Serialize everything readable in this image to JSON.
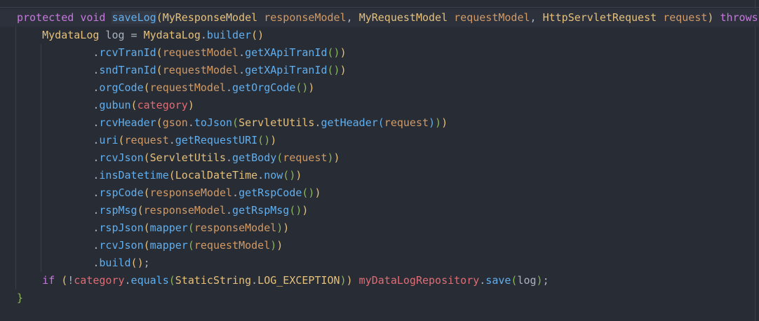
{
  "editor": {
    "current_line": 0,
    "lines": [
      {
        "indent": 0,
        "tokens": [
          [
            "protected",
            "kw"
          ],
          [
            " ",
            "pl"
          ],
          [
            "void",
            "kw"
          ],
          [
            " ",
            "pl"
          ],
          [
            "saveLog",
            "fn hl"
          ],
          [
            "(",
            "b1"
          ],
          [
            "MyResponseModel",
            "ty"
          ],
          [
            " ",
            "pl"
          ],
          [
            "responseModel",
            "pa"
          ],
          [
            ", ",
            "pl"
          ],
          [
            "MyRequestModel",
            "ty"
          ],
          [
            " ",
            "pl"
          ],
          [
            "requestModel",
            "pa"
          ],
          [
            ", ",
            "pl"
          ],
          [
            "HttpServletRequest",
            "ty"
          ],
          [
            " ",
            "pl"
          ],
          [
            "request",
            "pa"
          ],
          [
            ")",
            "b1"
          ],
          [
            " ",
            "pl"
          ],
          [
            "throws",
            "kw"
          ]
        ]
      },
      {
        "indent": 4,
        "tokens": [
          [
            "MydataLog",
            "ty"
          ],
          [
            " log = ",
            "pl"
          ],
          [
            "MydataLog",
            "ty"
          ],
          [
            ".",
            "pl"
          ],
          [
            "builder",
            "fn"
          ],
          [
            "()",
            "b1"
          ]
        ]
      },
      {
        "indent": 12,
        "tokens": [
          [
            ".",
            "pl"
          ],
          [
            "rcvTranId",
            "fn"
          ],
          [
            "(",
            "b1"
          ],
          [
            "requestModel",
            "pa"
          ],
          [
            ".",
            "pl"
          ],
          [
            "getXApiTranId",
            "fn"
          ],
          [
            "()",
            "b2"
          ],
          [
            ")",
            "b1"
          ]
        ]
      },
      {
        "indent": 12,
        "tokens": [
          [
            ".",
            "pl"
          ],
          [
            "sndTranId",
            "fn"
          ],
          [
            "(",
            "b1"
          ],
          [
            "requestModel",
            "pa"
          ],
          [
            ".",
            "pl"
          ],
          [
            "getXApiTranId",
            "fn"
          ],
          [
            "()",
            "b2"
          ],
          [
            ")",
            "b1"
          ]
        ]
      },
      {
        "indent": 12,
        "tokens": [
          [
            ".",
            "pl"
          ],
          [
            "orgCode",
            "fn"
          ],
          [
            "(",
            "b1"
          ],
          [
            "requestModel",
            "pa"
          ],
          [
            ".",
            "pl"
          ],
          [
            "getOrgCode",
            "fn"
          ],
          [
            "()",
            "b2"
          ],
          [
            ")",
            "b1"
          ]
        ]
      },
      {
        "indent": 12,
        "tokens": [
          [
            ".",
            "pl"
          ],
          [
            "gubun",
            "fn"
          ],
          [
            "(",
            "b1"
          ],
          [
            "category",
            "fi"
          ],
          [
            ")",
            "b1"
          ]
        ]
      },
      {
        "indent": 12,
        "tokens": [
          [
            ".",
            "pl"
          ],
          [
            "rcvHeader",
            "fn"
          ],
          [
            "(",
            "b1"
          ],
          [
            "gson",
            "pa"
          ],
          [
            ".",
            "pl"
          ],
          [
            "toJson",
            "fn"
          ],
          [
            "(",
            "b2"
          ],
          [
            "ServletUtils",
            "ty"
          ],
          [
            ".",
            "pl"
          ],
          [
            "getHeader",
            "fn"
          ],
          [
            "(",
            "b3"
          ],
          [
            "request",
            "pa"
          ],
          [
            ")",
            "b3"
          ],
          [
            ")",
            "b2"
          ],
          [
            ")",
            "b1"
          ]
        ]
      },
      {
        "indent": 12,
        "tokens": [
          [
            ".",
            "pl"
          ],
          [
            "uri",
            "fn"
          ],
          [
            "(",
            "b1"
          ],
          [
            "request",
            "pa"
          ],
          [
            ".",
            "pl"
          ],
          [
            "getRequestURI",
            "fn"
          ],
          [
            "()",
            "b2"
          ],
          [
            ")",
            "b1"
          ]
        ]
      },
      {
        "indent": 12,
        "tokens": [
          [
            ".",
            "pl"
          ],
          [
            "rcvJson",
            "fn"
          ],
          [
            "(",
            "b1"
          ],
          [
            "ServletUtils",
            "ty"
          ],
          [
            ".",
            "pl"
          ],
          [
            "getBody",
            "fn"
          ],
          [
            "(",
            "b2"
          ],
          [
            "request",
            "pa"
          ],
          [
            ")",
            "b2"
          ],
          [
            ")",
            "b1"
          ]
        ]
      },
      {
        "indent": 12,
        "tokens": [
          [
            ".",
            "pl"
          ],
          [
            "insDatetime",
            "fn"
          ],
          [
            "(",
            "b1"
          ],
          [
            "LocalDateTime",
            "ty"
          ],
          [
            ".",
            "pl"
          ],
          [
            "now",
            "fn"
          ],
          [
            "()",
            "b2"
          ],
          [
            ")",
            "b1"
          ]
        ]
      },
      {
        "indent": 12,
        "tokens": [
          [
            ".",
            "pl"
          ],
          [
            "rspCode",
            "fn"
          ],
          [
            "(",
            "b1"
          ],
          [
            "responseModel",
            "pa"
          ],
          [
            ".",
            "pl"
          ],
          [
            "getRspCode",
            "fn"
          ],
          [
            "()",
            "b2"
          ],
          [
            ")",
            "b1"
          ]
        ]
      },
      {
        "indent": 12,
        "tokens": [
          [
            ".",
            "pl"
          ],
          [
            "rspMsg",
            "fn"
          ],
          [
            "(",
            "b1"
          ],
          [
            "responseModel",
            "pa"
          ],
          [
            ".",
            "pl"
          ],
          [
            "getRspMsg",
            "fn"
          ],
          [
            "()",
            "b2"
          ],
          [
            ")",
            "b1"
          ]
        ]
      },
      {
        "indent": 12,
        "tokens": [
          [
            ".",
            "pl"
          ],
          [
            "rspJson",
            "fn"
          ],
          [
            "(",
            "b1"
          ],
          [
            "mapper",
            "fn"
          ],
          [
            "(",
            "b2"
          ],
          [
            "responseModel",
            "pa"
          ],
          [
            ")",
            "b2"
          ],
          [
            ")",
            "b1"
          ]
        ]
      },
      {
        "indent": 12,
        "tokens": [
          [
            ".",
            "pl"
          ],
          [
            "rcvJson",
            "fn"
          ],
          [
            "(",
            "b1"
          ],
          [
            "mapper",
            "fn"
          ],
          [
            "(",
            "b2"
          ],
          [
            "requestModel",
            "pa"
          ],
          [
            ")",
            "b2"
          ],
          [
            ")",
            "b1"
          ]
        ]
      },
      {
        "indent": 12,
        "tokens": [
          [
            ".",
            "pl"
          ],
          [
            "build",
            "fn"
          ],
          [
            "()",
            "b1"
          ],
          [
            ";",
            "pl"
          ]
        ]
      },
      {
        "indent": 4,
        "tokens": [
          [
            "if",
            "kw"
          ],
          [
            " ",
            "pl"
          ],
          [
            "(",
            "b1"
          ],
          [
            "!",
            "pl"
          ],
          [
            "category",
            "fi"
          ],
          [
            ".",
            "pl"
          ],
          [
            "equals",
            "fn"
          ],
          [
            "(",
            "b2"
          ],
          [
            "StaticString",
            "ty"
          ],
          [
            ".",
            "pl"
          ],
          [
            "LOG_EXCEPTION",
            "cn"
          ],
          [
            ")",
            "b2"
          ],
          [
            ")",
            "b1"
          ],
          [
            " ",
            "pl"
          ],
          [
            "myDataLogRepository",
            "fi"
          ],
          [
            ".",
            "pl"
          ],
          [
            "save",
            "fn"
          ],
          [
            "(",
            "b2"
          ],
          [
            "log",
            "pl"
          ],
          [
            ")",
            "b2"
          ],
          [
            ";",
            "pl"
          ]
        ]
      },
      {
        "indent": 0,
        "tokens": [
          [
            "}",
            "br"
          ]
        ]
      }
    ]
  }
}
